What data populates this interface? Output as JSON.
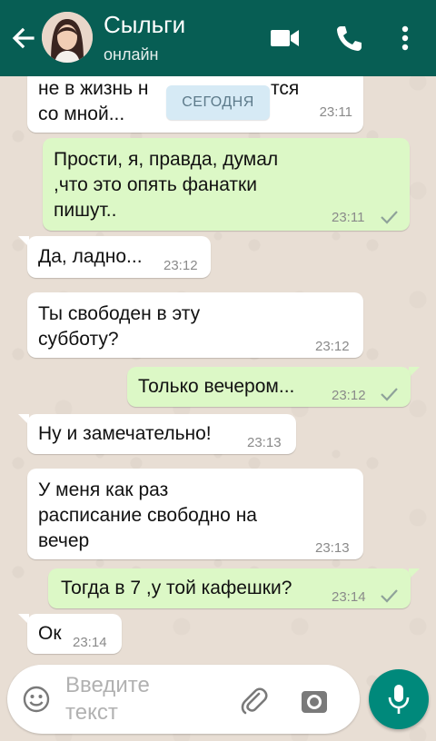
{
  "header": {
    "contact_name": "Сыльги",
    "status": "онлайн",
    "bg_color": "#075e54"
  },
  "date_chip": "СЕГОДНЯ",
  "messages": [
    {
      "direction": "in",
      "text_lines": [
        "не в жизнь н",
        "со мной..."
      ],
      "text_hidden_tail": "тся",
      "time": "23:11"
    },
    {
      "direction": "out",
      "text_lines": [
        "Прости, я, правда, думал",
        ",что это опять фанатки",
        "пишут.."
      ],
      "time": "23:11",
      "status": "sent"
    },
    {
      "direction": "in",
      "text_lines": [
        "Да, ладно..."
      ],
      "time": "23:12"
    },
    {
      "direction": "in",
      "text_lines": [
        "Ты свободен в эту",
        "субботу?"
      ],
      "time": "23:12"
    },
    {
      "direction": "out",
      "text_lines": [
        "Только вечером..."
      ],
      "time": "23:12",
      "status": "sent"
    },
    {
      "direction": "in",
      "text_lines": [
        "Ну и замечательно!"
      ],
      "time": "23:13"
    },
    {
      "direction": "in",
      "text_lines": [
        "У меня как раз",
        "расписание свободно на",
        "вечер"
      ],
      "time": "23:13"
    },
    {
      "direction": "out",
      "text_lines": [
        "Тогда в 7 ,у той кафешки?"
      ],
      "time": "23:14",
      "status": "sent"
    },
    {
      "direction": "in",
      "text_lines": [
        "Ок"
      ],
      "time": "23:14"
    }
  ],
  "composer": {
    "placeholder_line1": "Введите",
    "placeholder_line2": "текст"
  },
  "icons": {
    "back": "arrow-left",
    "video": "video-camera",
    "call": "phone",
    "menu": "more-vertical",
    "emoji": "smiley",
    "attach": "paperclip",
    "camera": "camera",
    "mic": "microphone"
  },
  "colors": {
    "incoming": "#ffffff",
    "outgoing": "#dcf8c6",
    "accent": "#00897b"
  }
}
